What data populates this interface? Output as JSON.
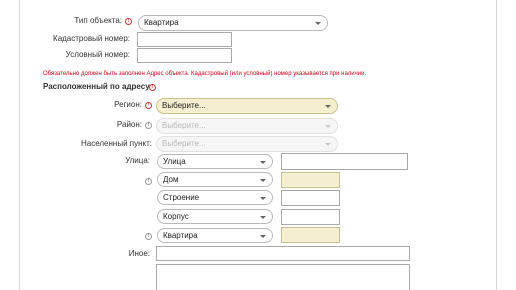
{
  "form": {
    "object_type_label": "Тип объекта:",
    "object_type_value": "Квартира",
    "cadastral_label": "Кадастровый номер:",
    "cadastral_value": "",
    "conditional_label": "Условный номер:",
    "conditional_value": "",
    "notice": "Обязательно должен быть заполнен Адрес объекта. Кадастровый (или условный) номер указывается при наличии.",
    "address_section": "Расположенный по адресу:",
    "region_label": "Регион:",
    "region_value": "Выберите...",
    "district_label": "Район:",
    "district_value": "Выберите...",
    "locality_label": "Населенный пункт:",
    "locality_value": "Выберите...",
    "street_label": "Улица:",
    "street_type": "Улица",
    "house_type": "Дом",
    "building_type": "Строение",
    "block_type": "Корпус",
    "apartment_type": "Квартира",
    "other_label": "Иное:"
  },
  "colors": {
    "highlight": "#f5efcf",
    "required_icon": "#c0392b",
    "notice": "#d0021b"
  },
  "icons": {
    "info": "!"
  }
}
